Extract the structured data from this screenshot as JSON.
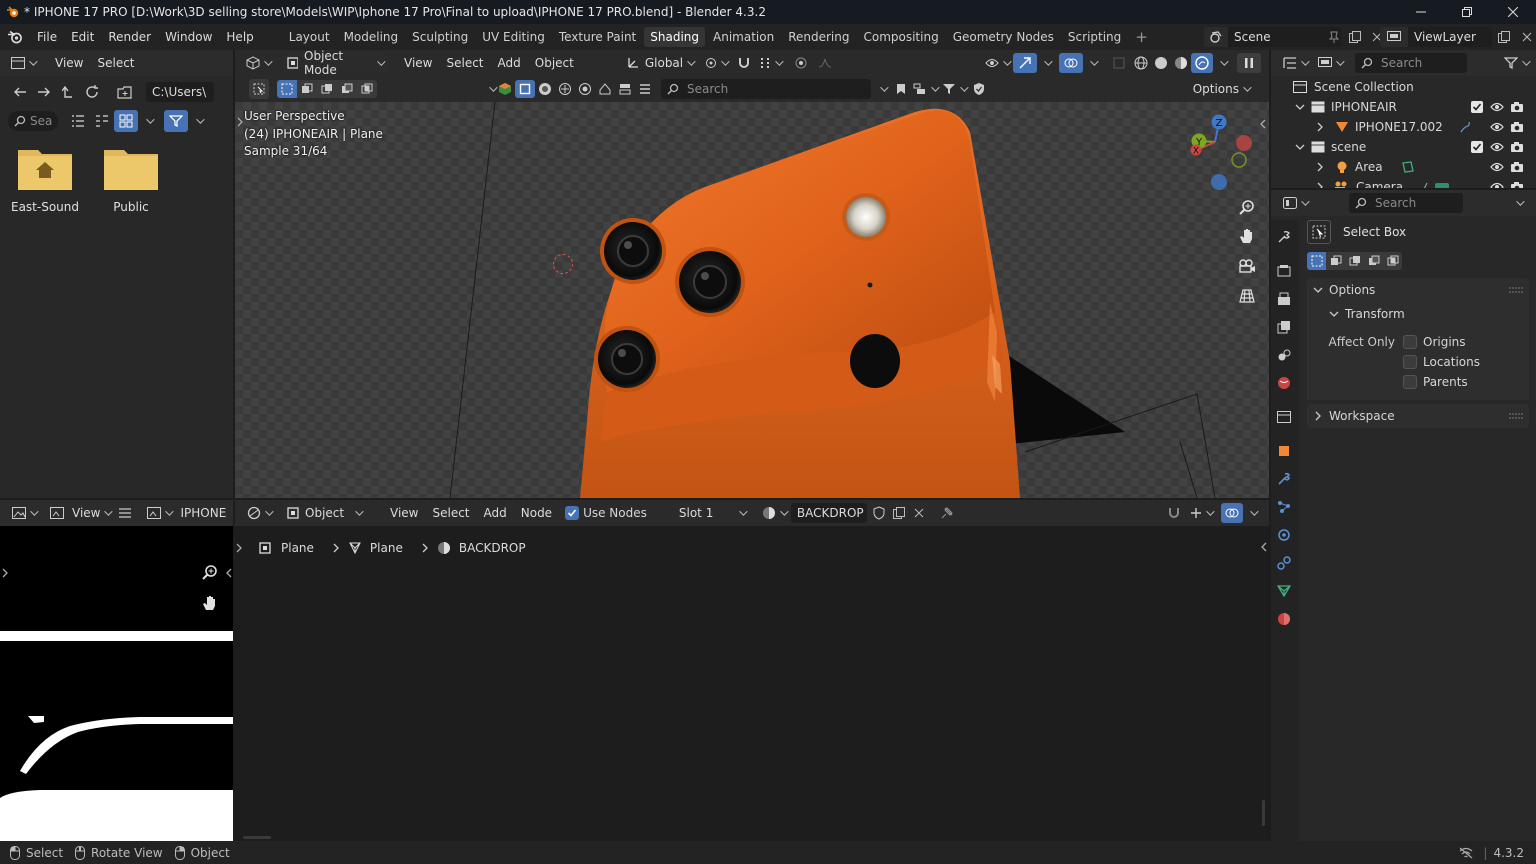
{
  "window": {
    "title": "* IPHONE 17 PRO [D:\\Work\\3D selling store\\Models\\WIP\\Iphone 17 Pro\\Final to upload\\IPHONE 17 PRO.blend] - Blender 4.3.2"
  },
  "menu": [
    "File",
    "Edit",
    "Render",
    "Window",
    "Help"
  ],
  "workspaces": [
    "Layout",
    "Modeling",
    "Sculpting",
    "UV Editing",
    "Texture Paint",
    "Shading",
    "Animation",
    "Rendering",
    "Compositing",
    "Geometry Nodes",
    "Scripting"
  ],
  "active_workspace": "Shading",
  "scene_name": "Scene",
  "view_layer": "ViewLayer",
  "file_browser": {
    "menu": [
      "View",
      "Select"
    ],
    "path": "C:\\Users\\",
    "search_placeholder": "Sea",
    "folders": [
      "East-Sound",
      "Public"
    ]
  },
  "viewport": {
    "mode": "Object Mode",
    "menu": [
      "View",
      "Select",
      "Add",
      "Object"
    ],
    "orientation": "Global",
    "search_placeholder": "Search",
    "options_label": "Options",
    "info_line1": "User Perspective",
    "info_line2": "(24) IPHONEAIR | Plane",
    "info_line3": "Sample 31/64"
  },
  "image_editor": {
    "view_label": "View",
    "image_name": "IPHONE"
  },
  "node_editor": {
    "type": "Object",
    "menu": [
      "View",
      "Select",
      "Add",
      "Node"
    ],
    "use_nodes_label": "Use Nodes",
    "use_nodes": true,
    "slot": "Slot 1",
    "material": "BACKDROP",
    "breadcrumb": [
      "Plane",
      "Plane",
      "BACKDROP"
    ]
  },
  "outliner": {
    "search_placeholder": "Search",
    "root": "Scene Collection",
    "items": [
      {
        "label": "IPHONEAIR",
        "level": 1,
        "type": "collection",
        "expanded": true,
        "checked": true
      },
      {
        "label": "IPHONE17.002",
        "level": 2,
        "type": "mesh",
        "expanded": false,
        "checked": false
      },
      {
        "label": "scene",
        "level": 1,
        "type": "collection",
        "expanded": true,
        "checked": true
      },
      {
        "label": "Area",
        "level": 2,
        "type": "light",
        "expanded": false,
        "checked": false
      },
      {
        "label": "Camera",
        "level": 2,
        "type": "camera",
        "expanded": false,
        "checked": false
      }
    ]
  },
  "properties": {
    "search_placeholder": "Search",
    "tool_name": "Select Box",
    "options_label": "Options",
    "transform_label": "Transform",
    "affect_only_label": "Affect Only",
    "affect_options": [
      "Origins",
      "Locations",
      "Parents"
    ],
    "workspace_label": "Workspace"
  },
  "statusbar": {
    "hints": [
      "Select",
      "Rotate View",
      "Object"
    ],
    "version": "4.3.2"
  },
  "colors": {
    "accent": "#4772b3",
    "phone_orange": "#e8641c",
    "bg_dark": "#1d1d1d"
  }
}
